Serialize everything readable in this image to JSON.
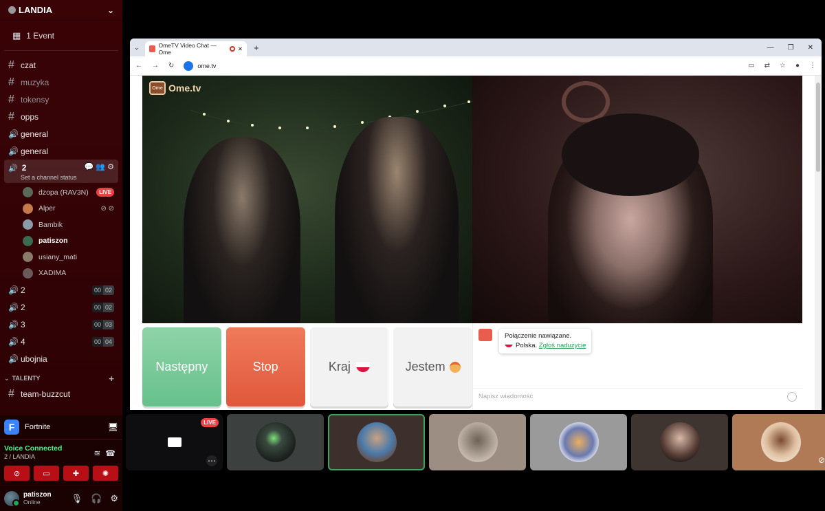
{
  "server": {
    "name": "LANDIA"
  },
  "event": {
    "label": "1 Event"
  },
  "channels": [
    {
      "name": "czat",
      "type": "text",
      "muted": false
    },
    {
      "name": "muzyka",
      "type": "text",
      "muted": true
    },
    {
      "name": "tokensy",
      "type": "text",
      "muted": true
    },
    {
      "name": "opps",
      "type": "text",
      "muted": false
    },
    {
      "name": "general",
      "type": "voice",
      "muted": false
    },
    {
      "name": "general",
      "type": "voice",
      "muted": false
    }
  ],
  "active_channel": {
    "name": "2",
    "status": "Set a channel status"
  },
  "voice_users": [
    {
      "name": "dzopa (RAV3N)",
      "live": "LIVE",
      "bold": false,
      "color": "#5a6a5a"
    },
    {
      "name": "Alper",
      "live": "",
      "bold": false,
      "color": "#c47a4a"
    },
    {
      "name": "Bambik",
      "live": "",
      "bold": false,
      "color": "#8a9aa8"
    },
    {
      "name": "patiszon",
      "live": "",
      "bold": true,
      "color": "#3a6a50"
    },
    {
      "name": "usiany_mati",
      "live": "",
      "bold": false,
      "color": "#8a7a6a"
    },
    {
      "name": "XADIMA",
      "live": "",
      "bold": false,
      "color": "#6a5a5a"
    }
  ],
  "voice_channels": [
    {
      "name": "2",
      "a": "00",
      "b": "02"
    },
    {
      "name": "2",
      "a": "00",
      "b": "02"
    },
    {
      "name": "3",
      "a": "00",
      "b": "03"
    },
    {
      "name": "4",
      "a": "00",
      "b": "04"
    }
  ],
  "extra_channel": "ubojnia",
  "category": "TALENTY",
  "category_channel": "team-buzzcut",
  "activity": {
    "game": "Fortnite"
  },
  "voice": {
    "status": "Voice Connected",
    "location": "2 / LANDIA"
  },
  "me": {
    "name": "patiszon",
    "status": "Online"
  },
  "browser": {
    "tab_title": "OmeTV Video Chat — Ome",
    "url": "ome.tv"
  },
  "ometv": {
    "logo": "Ome.tv",
    "next": "Następny",
    "stop": "Stop",
    "country": "Kraj",
    "iam": "Jestem",
    "msg_line1": "Połączenie nawiązane.",
    "msg_country": "Polska.",
    "msg_report": "Zgłoś nadużycie",
    "chat_placeholder": "Napisz wiadomość"
  },
  "tiles": {
    "live": "LIVE"
  }
}
